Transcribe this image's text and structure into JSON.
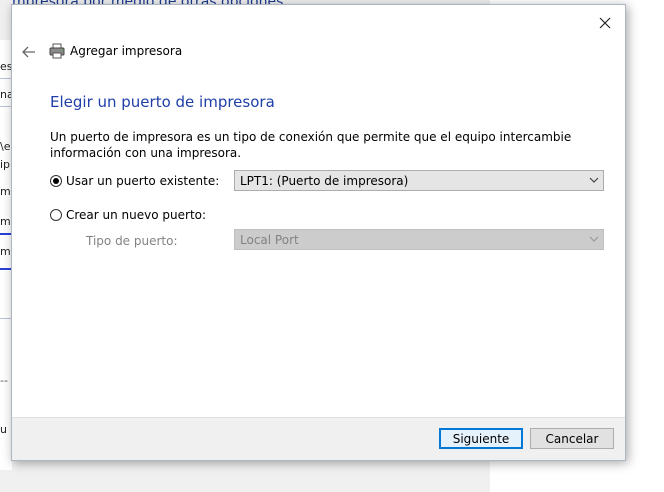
{
  "background_window": {
    "title_fragment": "mpresora por medio de otras opciones",
    "fragments": [
      "es",
      "na",
      "\\e",
      "ip",
      "m",
      "m",
      "m",
      "u"
    ]
  },
  "dialog": {
    "nav_title": "Agregar impresora",
    "heading": "Elegir un puerto de impresora",
    "description": "Un puerto de impresora es un tipo de conexión que permite que el equipo intercambie información con una impresora.",
    "use_existing": {
      "label": "Usar un puerto existente:",
      "checked": true,
      "selected_value": "LPT1: (Puerto de impresora)"
    },
    "create_new": {
      "label": "Crear un nuevo puerto:",
      "checked": false,
      "port_type_label": "Tipo de puerto:",
      "port_type_value": "Local Port",
      "disabled": true
    },
    "buttons": {
      "next": "Siguiente",
      "cancel": "Cancelar"
    },
    "icons": {
      "close": "close-icon",
      "back": "back-arrow-icon",
      "printer": "printer-icon",
      "dropdown": "chevron-down-icon"
    },
    "colors": {
      "heading": "#1f3ea7",
      "primary_button_border": "#0078d7",
      "footer_bg": "#f0f0f0"
    }
  }
}
